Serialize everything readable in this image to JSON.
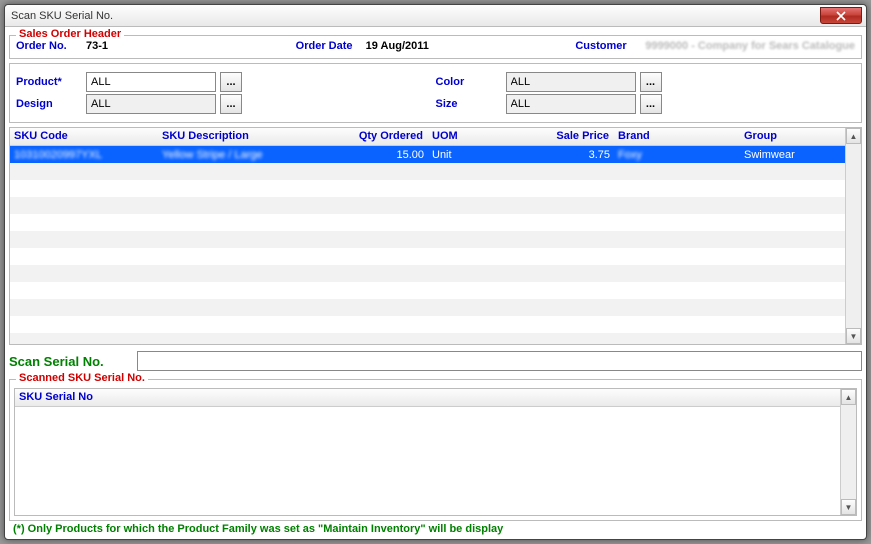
{
  "window": {
    "title": "Scan SKU Serial No."
  },
  "header": {
    "legend": "Sales Order Header",
    "orderNoLabel": "Order No.",
    "orderNo": "73-1",
    "orderDateLabel": "Order Date",
    "orderDate": "19 Aug/2011",
    "customerLabel": "Customer",
    "customer": "9999000 - Company for Sears Catalogue"
  },
  "filters": {
    "productLabel": "Product*",
    "productValue": "ALL",
    "colorLabel": "Color",
    "colorValue": "ALL",
    "designLabel": "Design",
    "designValue": "ALL",
    "sizeLabel": "Size",
    "sizeValue": "ALL"
  },
  "grid": {
    "columns": {
      "sku": "SKU Code",
      "desc": "SKU Description",
      "qty": "Qty Ordered",
      "uom": "UOM",
      "price": "Sale Price",
      "brand": "Brand",
      "group": "Group"
    },
    "rows": [
      {
        "sku": "10310020997YXL",
        "desc": "Yellow Stripe / Large",
        "qty": "15.00",
        "uom": "Unit",
        "price": "3.75",
        "brand": "Foxy",
        "group": "Swimwear",
        "selected": true
      }
    ]
  },
  "scan": {
    "label": "Scan Serial No.",
    "value": ""
  },
  "scanned": {
    "legend": "Scanned SKU Serial No.",
    "columns": {
      "serial": "SKU Serial No"
    }
  },
  "footer": "(*) Only Products for which the Product Family was set as \"Maintain Inventory\" will be display"
}
